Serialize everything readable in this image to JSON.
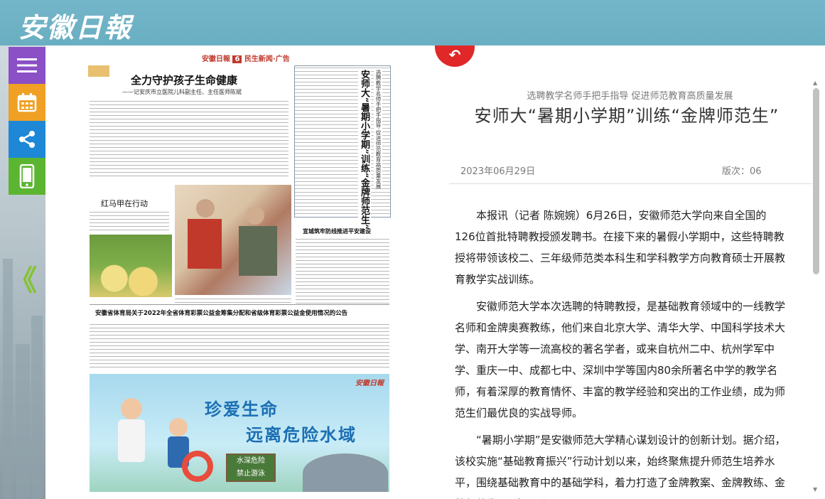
{
  "header": {
    "logo_text": "安徽日報"
  },
  "sidebar": {
    "items": [
      {
        "name": "menu-icon",
        "color": "#8b4fc6"
      },
      {
        "name": "calendar-icon",
        "color": "#f0a125"
      },
      {
        "name": "share-icon",
        "color": "#1e88d6"
      },
      {
        "name": "mobile-icon",
        "color": "#5cb531"
      }
    ],
    "prev_glyph": "《"
  },
  "newspaper": {
    "masthead": "安徽日報",
    "page_no": "6",
    "page_section": "民生新闻·广告",
    "headline": "全力守护孩子生命健康",
    "subhead": "——记安庆市立医院儿科副主任、主任医师陈斌",
    "vertical_title": "安师大“暑期小学期”训练“金牌师范生”",
    "vertical_sub": "选聘教学名师手把手指导 促进师范教育高质量发展",
    "photo_caption": "红马甲在行动",
    "side_headline": "宣城筑牢防线推进平安建设",
    "notice_title": "安徽省体育局关于2022年全省体育彩票公益金筹集分配和省级体育彩票公益金使用情况的公告",
    "ad": {
      "brand": "安徽日報",
      "line1": "珍爱生命",
      "line2": "远离危险水域",
      "sign_line1": "水深危险",
      "sign_line2": "禁止游泳"
    }
  },
  "article": {
    "back_glyph": "↶",
    "subtitle": "选聘教学名师手把手指导 促进师范教育高质量发展",
    "title": "安师大“暑期小学期”训练“金牌师范生”",
    "date": "2023年06月29日",
    "edition": "版次：06",
    "paragraphs": [
      "本报讯（记者 陈婉婉）6月26日，安徽师范大学向来自全国的126位首批特聘教授颁发聘书。在接下来的暑假小学期中，这些特聘教授将带领该校二、三年级师范类本科生和学科教学方向教育硕士开展教育教学实战训练。",
      "安徽师范大学本次选聘的特聘教授，是基础教育领域中的一线教学名师和金牌奥赛教练，他们来自北京大学、清华大学、中国科学技术大学、南开大学等一流高校的著名学者，或来自杭州二中、杭州学军中学、重庆一中、成都七中、深圳中学等国内80余所著名中学的教学名师，有着深厚的教育情怀、丰富的教学经验和突出的工作业绩，成为师范生们最优良的实战导师。",
      "“暑期小学期”是安徽师范大学精心谋划设计的创新计划。据介绍，该校实施“基础教育振兴”行动计划以来，始终聚焦提升师范生培养水平，围绕基础教育中的基础学科，着力打造了金牌教案、金牌教练、金牌师范生“三金”工程。"
    ]
  },
  "colors": {
    "accent": "#e02828",
    "header_bg": "#6fb3c7"
  }
}
